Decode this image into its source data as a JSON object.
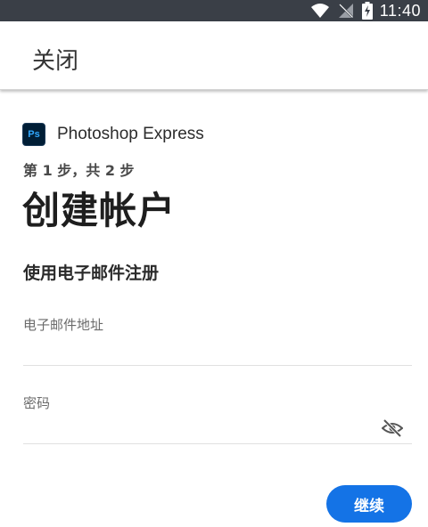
{
  "status_bar": {
    "time": "11:40",
    "icons": [
      "wifi-icon",
      "signal-off-icon",
      "battery-charging-icon"
    ]
  },
  "header": {
    "close_label": "关闭"
  },
  "brand": {
    "logo_text": "Ps",
    "name": "Photoshop Express"
  },
  "form": {
    "step_text": "第 1 步，共 2 步",
    "title": "创建帐户",
    "subtitle": "使用电子邮件注册",
    "email_label": "电子邮件地址",
    "email_value": "",
    "password_label": "密码",
    "password_value": "",
    "password_toggle_icon": "eye-off-icon",
    "continue_label": "继续"
  },
  "colors": {
    "status_bar": "#3a3f47",
    "accent": "#1473e6",
    "ps_logo_bg": "#001e36",
    "ps_logo_text": "#31a8ff"
  }
}
